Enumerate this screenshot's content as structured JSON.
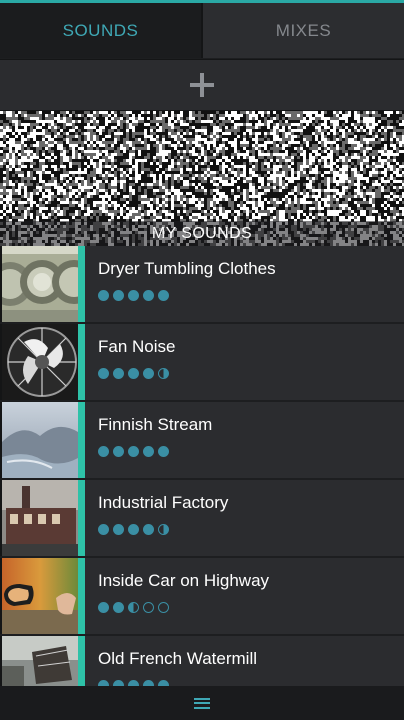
{
  "tabs": [
    {
      "label": "SOUNDS",
      "active": true
    },
    {
      "label": "MIXES",
      "active": false
    }
  ],
  "add_button": {
    "icon": "plus-icon"
  },
  "section": {
    "title": "MY SOUNDS"
  },
  "colors": {
    "accent": "#2ec2a8",
    "tab_active_text": "#3fa8b5",
    "dot": "#3a8fa4",
    "row_bg": "#2b2c2f",
    "background": "#1d1e20"
  },
  "sounds": [
    {
      "title": "Dryer Tumbling Clothes",
      "rating": 5,
      "thumbnail": "laundromat-dryers"
    },
    {
      "title": "Fan Noise",
      "rating": 4.5,
      "thumbnail": "electric-fan"
    },
    {
      "title": "Finnish Stream",
      "rating": 5,
      "thumbnail": "misty-stream"
    },
    {
      "title": "Industrial Factory",
      "rating": 4.5,
      "thumbnail": "factory-building"
    },
    {
      "title": "Inside Car on Highway",
      "rating": 2.5,
      "thumbnail": "car-side-mirror"
    },
    {
      "title": "Old French Watermill",
      "rating": null,
      "thumbnail": "watermill"
    }
  ],
  "bottom_bar": {
    "icon": "menu-icon"
  }
}
